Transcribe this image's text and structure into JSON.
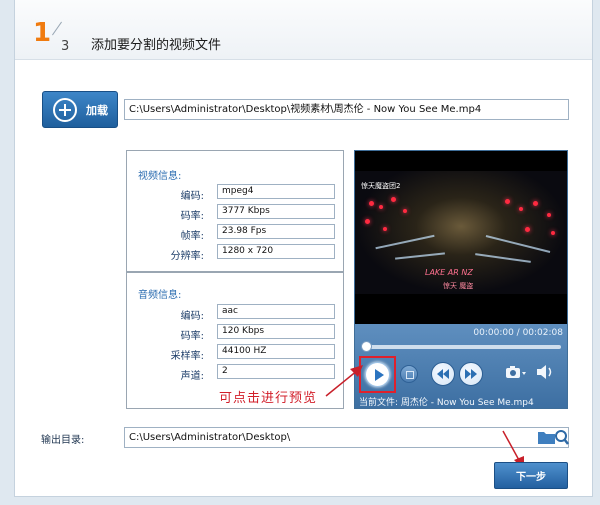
{
  "step": {
    "current": "1",
    "total": "3",
    "title": "添加要分割的视频文件"
  },
  "add_button": {
    "label": "加载"
  },
  "file_path": "C:\\Users\\Administrator\\Desktop\\视频素材\\周杰伦 - Now You See Me.mp4",
  "video_info": {
    "title": "视频信息:",
    "rows": [
      {
        "label": "编码:",
        "value": "mpeg4"
      },
      {
        "label": "码率:",
        "value": "3777 Kbps"
      },
      {
        "label": "帧率:",
        "value": "23.98 Fps"
      },
      {
        "label": "分辨率:",
        "value": "1280 x 720"
      }
    ]
  },
  "audio_info": {
    "title": "音频信息:",
    "rows": [
      {
        "label": "编码:",
        "value": "aac"
      },
      {
        "label": "码率:",
        "value": "120 Kbps"
      },
      {
        "label": "采样率:",
        "value": "44100 HZ"
      },
      {
        "label": "声道:",
        "value": "2"
      }
    ]
  },
  "player": {
    "time": "00:00:00 / 00:02:08",
    "current_file": "当前文件: 周杰伦 - Now You See Me.mp4",
    "progress": 0,
    "frame_title": "惊天魔盗团2",
    "frame_sub": "LAKE  AR NZ",
    "frame_sub2": "惊天 魔盗"
  },
  "hint": "可点击进行预览",
  "output": {
    "label": "输出目录:",
    "path": "C:\\Users\\Administrator\\Desktop\\"
  },
  "next_button": {
    "label": "下一步"
  },
  "colors": {
    "accent_orange": "#f07b0f",
    "button_blue": "#2360a0",
    "hint_red": "#d21f2a"
  }
}
